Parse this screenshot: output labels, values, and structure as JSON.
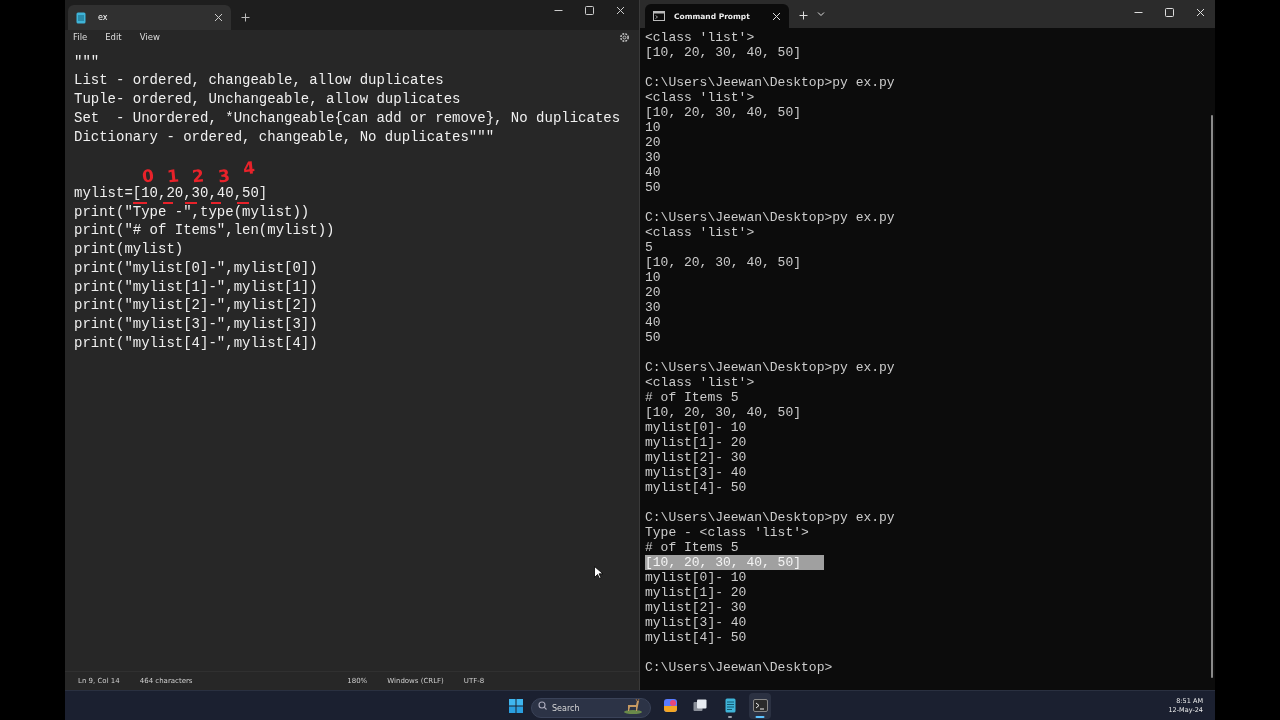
{
  "notepad": {
    "tabs": [
      {
        "label": "ex",
        "selected": true
      }
    ],
    "menu": [
      "File",
      "Edit",
      "View"
    ],
    "blocks": [
      [
        "\"\"\"",
        "List - ordered, changeable, allow duplicates",
        "Tuple- ordered, Unchangeable, allow duplicates",
        "Set  - Unordered, *Unchangeable{can add or remove}, No duplicates",
        "Dictionary - ordered, changeable, No duplicates\"\"\""
      ],
      [
        "mylist=[10,20,30,40,50]",
        "print(\"Type -\",type(mylist))",
        "print(\"# of Items\",len(mylist))",
        "print(mylist)",
        "print(\"mylist[0]-\",mylist[0])",
        "print(\"mylist[1]-\",mylist[1])",
        "print(\"mylist[2]-\",mylist[2])",
        "print(\"mylist[3]-\",mylist[3])",
        "print(\"mylist[4]-\",mylist[4])"
      ]
    ],
    "annotations": [
      {
        "text": "0"
      },
      {
        "text": "1"
      },
      {
        "text": "2"
      },
      {
        "text": "3"
      },
      {
        "text": "4"
      }
    ],
    "status": {
      "position": "Ln 9, Col 14",
      "characters": "464 characters",
      "zoom": "180%",
      "line_ending": "Windows (CRLF)",
      "encoding": "UTF-8"
    }
  },
  "cmd": {
    "tabs": [
      {
        "label": "Command Prompt",
        "selected": true
      }
    ],
    "blocks": [
      [
        {
          "text": "<class 'list'>",
          "selected": false
        },
        {
          "text": "[10, 20, 30, 40, 50]",
          "selected": false
        }
      ],
      [
        {
          "text": "C:\\Users\\Jeewan\\Desktop>py ex.py",
          "selected": false
        },
        {
          "text": "<class 'list'>",
          "selected": false
        },
        {
          "text": "[10, 20, 30, 40, 50]",
          "selected": false
        },
        {
          "text": "10",
          "selected": false
        },
        {
          "text": "20",
          "selected": false
        },
        {
          "text": "30",
          "selected": false
        },
        {
          "text": "40",
          "selected": false
        },
        {
          "text": "50",
          "selected": false
        }
      ],
      [
        {
          "text": "C:\\Users\\Jeewan\\Desktop>py ex.py",
          "selected": false
        },
        {
          "text": "<class 'list'>",
          "selected": false
        },
        {
          "text": "5",
          "selected": false
        },
        {
          "text": "[10, 20, 30, 40, 50]",
          "selected": false
        },
        {
          "text": "10",
          "selected": false
        },
        {
          "text": "20",
          "selected": false
        },
        {
          "text": "30",
          "selected": false
        },
        {
          "text": "40",
          "selected": false
        },
        {
          "text": "50",
          "selected": false
        }
      ],
      [
        {
          "text": "C:\\Users\\Jeewan\\Desktop>py ex.py",
          "selected": false
        },
        {
          "text": "<class 'list'>",
          "selected": false
        },
        {
          "text": "# of Items 5",
          "selected": false
        },
        {
          "text": "[10, 20, 30, 40, 50]",
          "selected": false
        },
        {
          "text": "mylist[0]- 10",
          "selected": false
        },
        {
          "text": "mylist[1]- 20",
          "selected": false
        },
        {
          "text": "mylist[2]- 30",
          "selected": false
        },
        {
          "text": "mylist[3]- 40",
          "selected": false
        },
        {
          "text": "mylist[4]- 50",
          "selected": false
        }
      ],
      [
        {
          "text": "C:\\Users\\Jeewan\\Desktop>py ex.py",
          "selected": false
        },
        {
          "text": "Type - <class 'list'>",
          "selected": false
        },
        {
          "text": "# of Items 5",
          "selected": false
        },
        {
          "text": "[10, 20, 30, 40, 50]",
          "selected": true
        },
        {
          "text": "mylist[0]- 10",
          "selected": false
        },
        {
          "text": "mylist[1]- 20",
          "selected": false
        },
        {
          "text": "mylist[2]- 30",
          "selected": false
        },
        {
          "text": "mylist[3]- 40",
          "selected": false
        },
        {
          "text": "mylist[4]- 50",
          "selected": false
        }
      ],
      [
        {
          "text": "C:\\Users\\Jeewan\\Desktop>",
          "selected": false
        }
      ]
    ]
  },
  "taskbar": {
    "search": {
      "placeholder": "Search"
    },
    "apps": [
      {
        "kind": "copilot",
        "running": false,
        "active": false
      },
      {
        "kind": "taskview",
        "running": false,
        "active": false
      },
      {
        "kind": "notepad",
        "running": true,
        "active": false
      },
      {
        "kind": "terminal",
        "running": true,
        "active": true
      }
    ],
    "clock": {
      "time": "8:51 AM",
      "date": "12-May-24"
    }
  }
}
